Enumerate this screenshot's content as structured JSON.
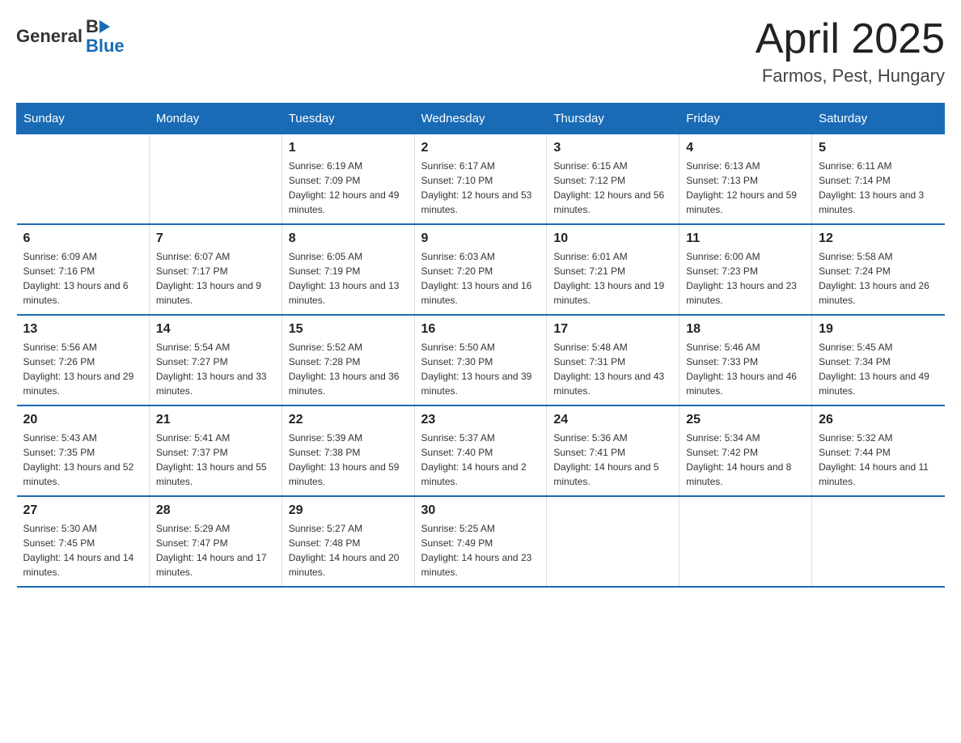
{
  "header": {
    "logo_general": "General",
    "logo_blue": "Blue",
    "title": "April 2025",
    "subtitle": "Farmos, Pest, Hungary"
  },
  "days_of_week": [
    "Sunday",
    "Monday",
    "Tuesday",
    "Wednesday",
    "Thursday",
    "Friday",
    "Saturday"
  ],
  "weeks": [
    [
      {
        "day": "",
        "sunrise": "",
        "sunset": "",
        "daylight": ""
      },
      {
        "day": "",
        "sunrise": "",
        "sunset": "",
        "daylight": ""
      },
      {
        "day": "1",
        "sunrise": "Sunrise: 6:19 AM",
        "sunset": "Sunset: 7:09 PM",
        "daylight": "Daylight: 12 hours and 49 minutes."
      },
      {
        "day": "2",
        "sunrise": "Sunrise: 6:17 AM",
        "sunset": "Sunset: 7:10 PM",
        "daylight": "Daylight: 12 hours and 53 minutes."
      },
      {
        "day": "3",
        "sunrise": "Sunrise: 6:15 AM",
        "sunset": "Sunset: 7:12 PM",
        "daylight": "Daylight: 12 hours and 56 minutes."
      },
      {
        "day": "4",
        "sunrise": "Sunrise: 6:13 AM",
        "sunset": "Sunset: 7:13 PM",
        "daylight": "Daylight: 12 hours and 59 minutes."
      },
      {
        "day": "5",
        "sunrise": "Sunrise: 6:11 AM",
        "sunset": "Sunset: 7:14 PM",
        "daylight": "Daylight: 13 hours and 3 minutes."
      }
    ],
    [
      {
        "day": "6",
        "sunrise": "Sunrise: 6:09 AM",
        "sunset": "Sunset: 7:16 PM",
        "daylight": "Daylight: 13 hours and 6 minutes."
      },
      {
        "day": "7",
        "sunrise": "Sunrise: 6:07 AM",
        "sunset": "Sunset: 7:17 PM",
        "daylight": "Daylight: 13 hours and 9 minutes."
      },
      {
        "day": "8",
        "sunrise": "Sunrise: 6:05 AM",
        "sunset": "Sunset: 7:19 PM",
        "daylight": "Daylight: 13 hours and 13 minutes."
      },
      {
        "day": "9",
        "sunrise": "Sunrise: 6:03 AM",
        "sunset": "Sunset: 7:20 PM",
        "daylight": "Daylight: 13 hours and 16 minutes."
      },
      {
        "day": "10",
        "sunrise": "Sunrise: 6:01 AM",
        "sunset": "Sunset: 7:21 PM",
        "daylight": "Daylight: 13 hours and 19 minutes."
      },
      {
        "day": "11",
        "sunrise": "Sunrise: 6:00 AM",
        "sunset": "Sunset: 7:23 PM",
        "daylight": "Daylight: 13 hours and 23 minutes."
      },
      {
        "day": "12",
        "sunrise": "Sunrise: 5:58 AM",
        "sunset": "Sunset: 7:24 PM",
        "daylight": "Daylight: 13 hours and 26 minutes."
      }
    ],
    [
      {
        "day": "13",
        "sunrise": "Sunrise: 5:56 AM",
        "sunset": "Sunset: 7:26 PM",
        "daylight": "Daylight: 13 hours and 29 minutes."
      },
      {
        "day": "14",
        "sunrise": "Sunrise: 5:54 AM",
        "sunset": "Sunset: 7:27 PM",
        "daylight": "Daylight: 13 hours and 33 minutes."
      },
      {
        "day": "15",
        "sunrise": "Sunrise: 5:52 AM",
        "sunset": "Sunset: 7:28 PM",
        "daylight": "Daylight: 13 hours and 36 minutes."
      },
      {
        "day": "16",
        "sunrise": "Sunrise: 5:50 AM",
        "sunset": "Sunset: 7:30 PM",
        "daylight": "Daylight: 13 hours and 39 minutes."
      },
      {
        "day": "17",
        "sunrise": "Sunrise: 5:48 AM",
        "sunset": "Sunset: 7:31 PM",
        "daylight": "Daylight: 13 hours and 43 minutes."
      },
      {
        "day": "18",
        "sunrise": "Sunrise: 5:46 AM",
        "sunset": "Sunset: 7:33 PM",
        "daylight": "Daylight: 13 hours and 46 minutes."
      },
      {
        "day": "19",
        "sunrise": "Sunrise: 5:45 AM",
        "sunset": "Sunset: 7:34 PM",
        "daylight": "Daylight: 13 hours and 49 minutes."
      }
    ],
    [
      {
        "day": "20",
        "sunrise": "Sunrise: 5:43 AM",
        "sunset": "Sunset: 7:35 PM",
        "daylight": "Daylight: 13 hours and 52 minutes."
      },
      {
        "day": "21",
        "sunrise": "Sunrise: 5:41 AM",
        "sunset": "Sunset: 7:37 PM",
        "daylight": "Daylight: 13 hours and 55 minutes."
      },
      {
        "day": "22",
        "sunrise": "Sunrise: 5:39 AM",
        "sunset": "Sunset: 7:38 PM",
        "daylight": "Daylight: 13 hours and 59 minutes."
      },
      {
        "day": "23",
        "sunrise": "Sunrise: 5:37 AM",
        "sunset": "Sunset: 7:40 PM",
        "daylight": "Daylight: 14 hours and 2 minutes."
      },
      {
        "day": "24",
        "sunrise": "Sunrise: 5:36 AM",
        "sunset": "Sunset: 7:41 PM",
        "daylight": "Daylight: 14 hours and 5 minutes."
      },
      {
        "day": "25",
        "sunrise": "Sunrise: 5:34 AM",
        "sunset": "Sunset: 7:42 PM",
        "daylight": "Daylight: 14 hours and 8 minutes."
      },
      {
        "day": "26",
        "sunrise": "Sunrise: 5:32 AM",
        "sunset": "Sunset: 7:44 PM",
        "daylight": "Daylight: 14 hours and 11 minutes."
      }
    ],
    [
      {
        "day": "27",
        "sunrise": "Sunrise: 5:30 AM",
        "sunset": "Sunset: 7:45 PM",
        "daylight": "Daylight: 14 hours and 14 minutes."
      },
      {
        "day": "28",
        "sunrise": "Sunrise: 5:29 AM",
        "sunset": "Sunset: 7:47 PM",
        "daylight": "Daylight: 14 hours and 17 minutes."
      },
      {
        "day": "29",
        "sunrise": "Sunrise: 5:27 AM",
        "sunset": "Sunset: 7:48 PM",
        "daylight": "Daylight: 14 hours and 20 minutes."
      },
      {
        "day": "30",
        "sunrise": "Sunrise: 5:25 AM",
        "sunset": "Sunset: 7:49 PM",
        "daylight": "Daylight: 14 hours and 23 minutes."
      },
      {
        "day": "",
        "sunrise": "",
        "sunset": "",
        "daylight": ""
      },
      {
        "day": "",
        "sunrise": "",
        "sunset": "",
        "daylight": ""
      },
      {
        "day": "",
        "sunrise": "",
        "sunset": "",
        "daylight": ""
      }
    ]
  ]
}
